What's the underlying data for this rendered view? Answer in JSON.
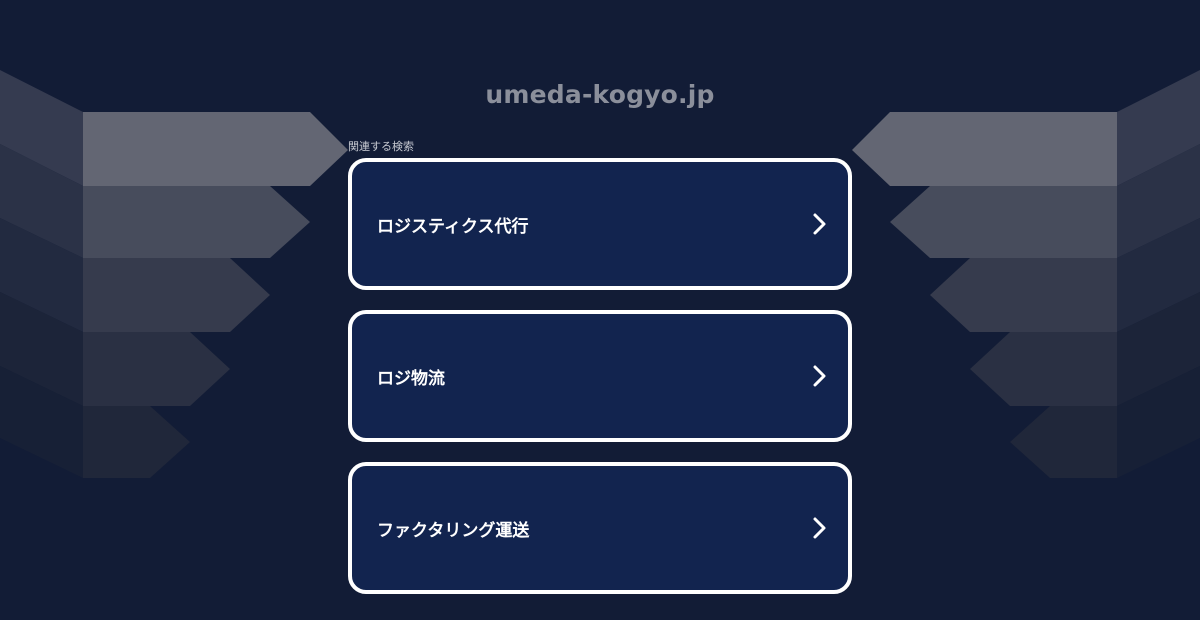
{
  "site": {
    "domain": "umeda-kogyo.jp"
  },
  "related": {
    "label": "関連する検索",
    "items": [
      {
        "label": "ロジスティクス代行"
      },
      {
        "label": "ロジ物流"
      },
      {
        "label": "ファクタリング運送"
      }
    ]
  },
  "icons": {
    "item_arrow": "chevron-right-icon"
  },
  "colors": {
    "background": "#121c36",
    "card": "#12244f",
    "card_border": "#ffffff",
    "domain_text": "#8b8f9b"
  }
}
